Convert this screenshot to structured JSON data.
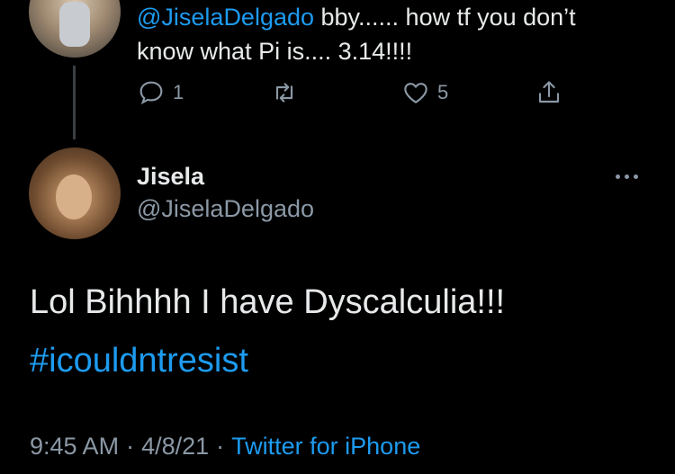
{
  "reply": {
    "mention": "@JiselaDelgado",
    "text_line1": " bby...... how tf you don’t",
    "text_line2": "know what Pi is.... 3.14!!!!",
    "actions": {
      "reply_count": "1",
      "retweet_count": "",
      "like_count": "5"
    }
  },
  "tweet": {
    "display_name": "Jisela",
    "handle": "@JiselaDelgado",
    "body": "Lol Bihhhh I have Dyscalculia!!!",
    "hashtag": "#icouldntresist",
    "time": "9:45 AM",
    "separator": "·",
    "date": "4/8/21",
    "source": "Twitter for iPhone"
  }
}
